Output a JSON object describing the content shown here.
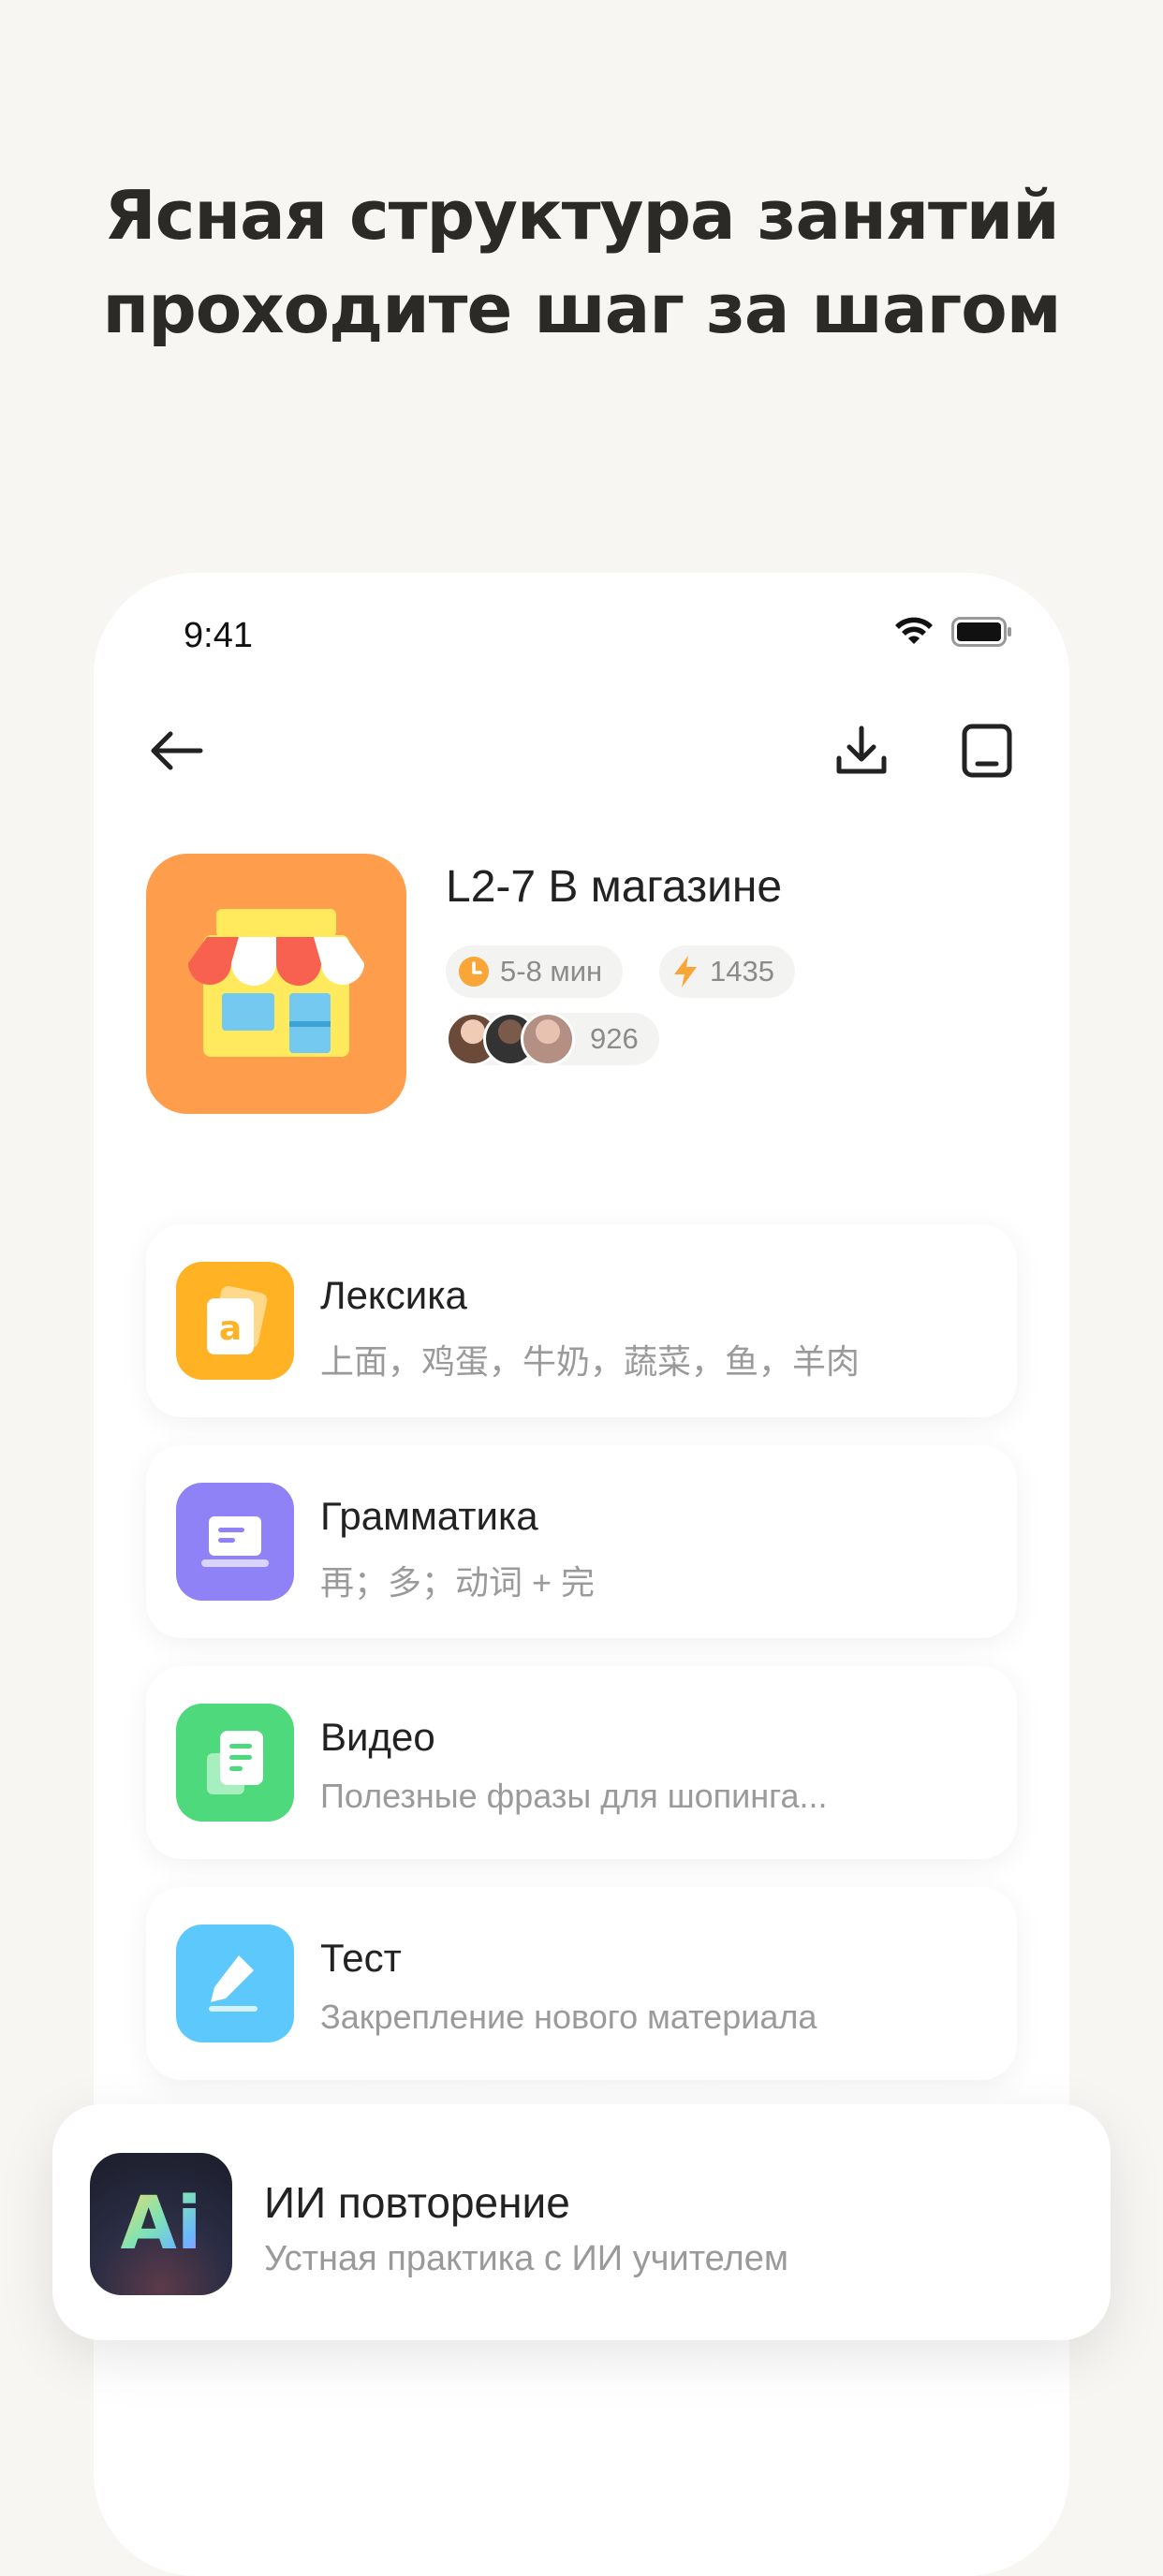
{
  "promo": {
    "line1": "Ясная структура занятий",
    "line2": "проходите шаг за шагом"
  },
  "status": {
    "time": "9:41"
  },
  "lesson": {
    "title": "L2-7 В магазине",
    "duration": "5-8 мин",
    "xp": "1435",
    "learners": "926"
  },
  "sections": [
    {
      "title": "Лексика",
      "subtitle": "上面，鸡蛋，牛奶，蔬菜，鱼，羊肉",
      "color": "#ffb224"
    },
    {
      "title": "Грамматика",
      "subtitle": "再；多；动词 + 完",
      "color": "#8f82f6"
    },
    {
      "title": "Видео",
      "subtitle": "Полезные фразы для шопинга...",
      "color": "#4ed97c"
    },
    {
      "title": "Тест",
      "subtitle": "Закрепление нового материала",
      "color": "#5cc8fb"
    }
  ],
  "ai_review": {
    "icon_text": "Ai",
    "title": "ИИ повторение",
    "subtitle": "Устная практика с ИИ учителем"
  },
  "colors": {
    "background": "#f7f6f2",
    "lesson_icon": "#fe9d4b",
    "duration_icon": "#f7a637",
    "xp_icon": "#f7a637"
  }
}
